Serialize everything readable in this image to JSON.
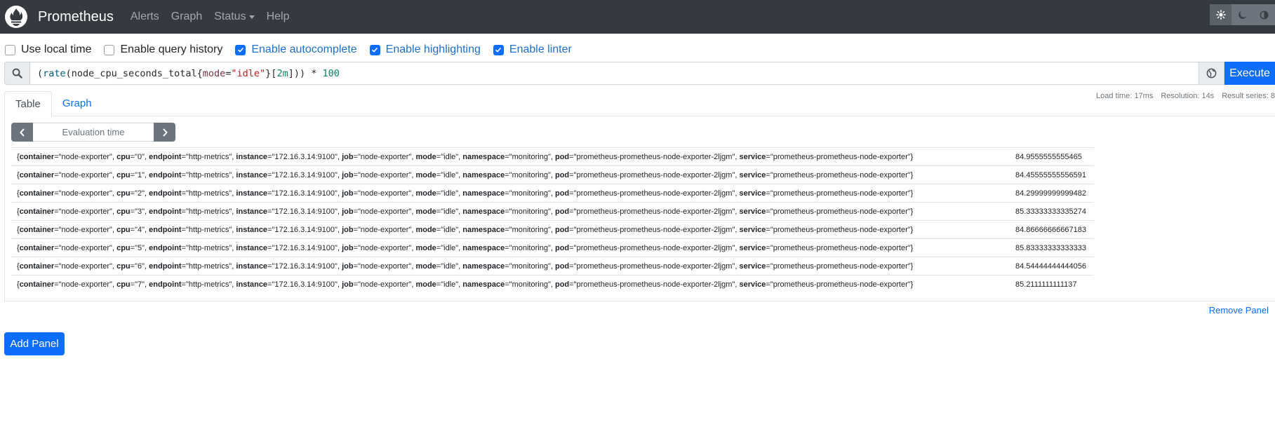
{
  "navbar": {
    "brand": "Prometheus",
    "links": [
      {
        "label": "Alerts"
      },
      {
        "label": "Graph"
      },
      {
        "label": "Status"
      },
      {
        "label": "Help"
      }
    ],
    "theme_buttons": [
      "light-theme-icon",
      "dark-theme-icon",
      "auto-theme-icon"
    ]
  },
  "options": [
    {
      "label": "Use local time",
      "checked": false
    },
    {
      "label": "Enable query history",
      "checked": false
    },
    {
      "label": "Enable autocomplete",
      "checked": true
    },
    {
      "label": "Enable highlighting",
      "checked": true
    },
    {
      "label": "Enable linter",
      "checked": true
    }
  ],
  "query": {
    "tokens": [
      {
        "t": "(",
        "c": ""
      },
      {
        "t": "rate",
        "c": "tk-fn"
      },
      {
        "t": "(node_cpu_seconds_total{",
        "c": ""
      },
      {
        "t": "mode",
        "c": "tk-lbl"
      },
      {
        "t": "=",
        "c": ""
      },
      {
        "t": "\"idle\"",
        "c": "tk-str"
      },
      {
        "t": "}[",
        "c": ""
      },
      {
        "t": "2m",
        "c": "tk-num"
      },
      {
        "t": "])) * ",
        "c": ""
      },
      {
        "t": "100",
        "c": "tk-num"
      }
    ],
    "execute_label": "Execute"
  },
  "tabs": [
    {
      "label": "Table",
      "active": true
    },
    {
      "label": "Graph",
      "active": false
    }
  ],
  "stats": {
    "load_time": "Load time: 17ms",
    "resolution": "Resolution: 14s",
    "result_series": "Result series: 8"
  },
  "eval": {
    "placeholder": "Evaluation time"
  },
  "results": [
    {
      "cpu": "0",
      "value": "84.9555555555465"
    },
    {
      "cpu": "1",
      "value": "84.45555555556591"
    },
    {
      "cpu": "2",
      "value": "84.29999999999482"
    },
    {
      "cpu": "3",
      "value": "85.33333333335274"
    },
    {
      "cpu": "4",
      "value": "84.86666666667183"
    },
    {
      "cpu": "5",
      "value": "85.83333333333333"
    },
    {
      "cpu": "6",
      "value": "84.54444444444056"
    },
    {
      "cpu": "7",
      "value": "85.2111111111137"
    }
  ],
  "common_labels": {
    "container": "node-exporter",
    "endpoint": "http-metrics",
    "instance": "172.16.3.14:9100",
    "job": "node-exporter",
    "mode": "idle",
    "namespace": "monitoring",
    "pod": "prometheus-prometheus-node-exporter-2ljgm",
    "service": "prometheus-prometheus-node-exporter"
  },
  "remove_panel_label": "Remove Panel",
  "add_panel_label": "Add Panel",
  "colors": {
    "navbar": "#343a40",
    "primary": "#0d6efd",
    "link_on": "#1d6fc8"
  }
}
